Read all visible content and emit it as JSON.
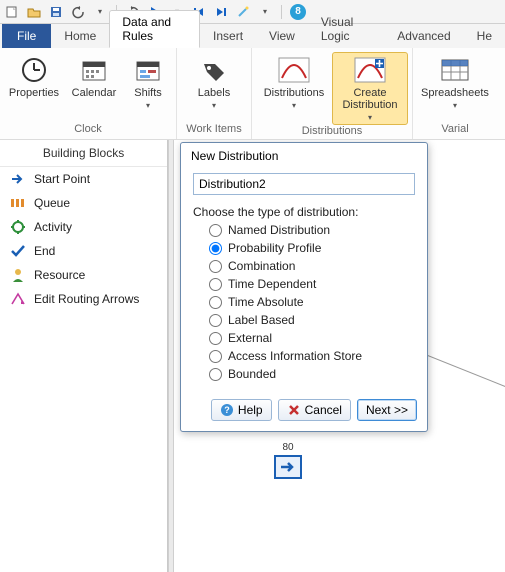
{
  "qat": {
    "circle_number": "8"
  },
  "tabs": {
    "file": "File",
    "items": [
      "Home",
      "Data and Rules",
      "Insert",
      "View",
      "Visual Logic",
      "Advanced",
      "He"
    ],
    "active_index": 1
  },
  "ribbon": {
    "groups": [
      {
        "label": "Clock",
        "items": [
          {
            "label": "Properties",
            "dropdown": false
          },
          {
            "label": "Calendar",
            "dropdown": false
          },
          {
            "label": "Shifts",
            "dropdown": true
          }
        ]
      },
      {
        "label": "Work Items",
        "items": [
          {
            "label": "Labels",
            "dropdown": true
          }
        ]
      },
      {
        "label": "Distributions",
        "items": [
          {
            "label": "Distributions",
            "dropdown": true
          },
          {
            "label": "Create Distribution",
            "dropdown": true,
            "highlight": true
          }
        ]
      },
      {
        "label": "Varial",
        "items": [
          {
            "label": "Spreadsheets",
            "dropdown": true
          }
        ]
      }
    ]
  },
  "sidebar": {
    "title": "Building Blocks",
    "items": [
      {
        "label": "Start Point"
      },
      {
        "label": "Queue"
      },
      {
        "label": "Activity"
      },
      {
        "label": "End"
      },
      {
        "label": "Resource"
      },
      {
        "label": "Edit Routing Arrows"
      }
    ]
  },
  "dialog": {
    "title": "New Distribution",
    "name_value": "Distribution2",
    "choose_label": "Choose the type of distribution:",
    "options": [
      "Named Distribution",
      "Probability Profile",
      "Combination",
      "Time Dependent",
      "Time Absolute",
      "Label Based",
      "External",
      "Access Information Store",
      "Bounded"
    ],
    "selected_index": 1,
    "buttons": {
      "help": "Help",
      "cancel": "Cancel",
      "next": "Next >>"
    }
  },
  "canvas": {
    "port_label": "80"
  }
}
